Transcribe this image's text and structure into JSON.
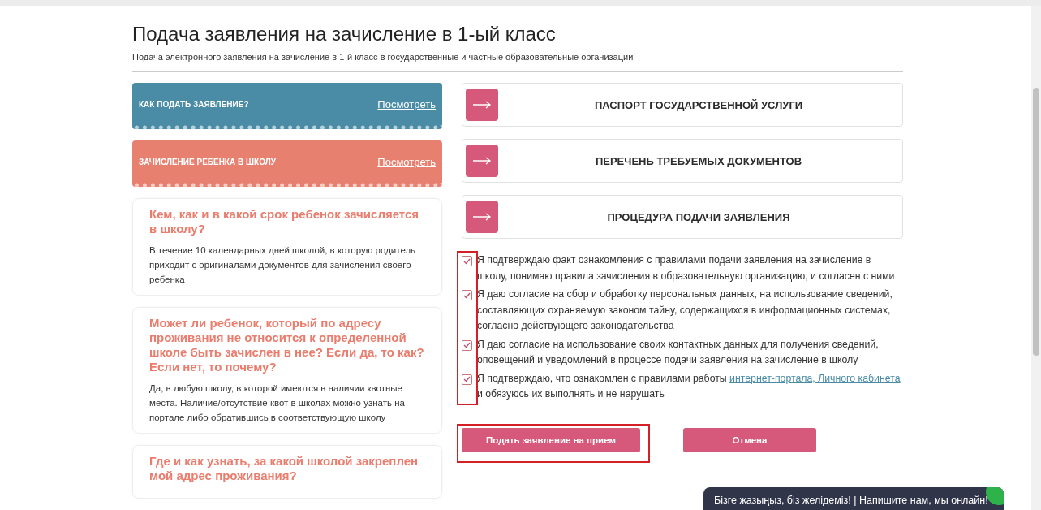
{
  "page": {
    "title": "Подача заявления на зачисление в 1-ый класс",
    "subtitle": "Подача электронного заявления на зачисление в 1-й класс в государственные и частные образовательные организации"
  },
  "banners": [
    {
      "title": "КАК ПОДАТЬ ЗАЯВЛЕНИЕ?",
      "link": "Посмотреть",
      "color": "#4a8ca6"
    },
    {
      "title": "ЗАЧИСЛЕНИЕ РЕБЕНКА В ШКОЛУ",
      "link": "Посмотреть",
      "color": "#e88070"
    }
  ],
  "faq": [
    {
      "question": "Кем, как и в какой срок ребенок зачисляется в школу?",
      "answer": "В течение 10 календарных дней школой, в которую родитель приходит с оригиналами документов для зачисления своего ребенка"
    },
    {
      "question": "Может ли ребенок, который по адресу проживания не относится к определенной школе быть зачислен в нее? Если да, то как? Если нет, то почему?",
      "answer": "Да, в любую школу, в которой имеются в наличии квотные места. Наличие/отсутствие квот в школах можно узнать на портале либо обратившись в соответствующую школу"
    },
    {
      "question": "Где и как узнать, за какой школой закреплен мой адрес проживания?"
    }
  ],
  "sections": [
    {
      "title": "ПАСПОРТ ГОСУДАРСТВЕННОЙ УСЛУГИ"
    },
    {
      "title": "ПЕРЕЧЕНЬ ТРЕБУЕМЫХ ДОКУМЕНТОВ"
    },
    {
      "title": "ПРОЦЕДУРА ПОДАЧИ ЗАЯВЛЕНИЯ"
    }
  ],
  "consents_highlighted": true,
  "consents": [
    {
      "text": "Я подтверждаю факт ознакомления с правилами подачи заявления на зачисление в школу, понимаю правила зачисления в образовательную организацию, и согласен с ними",
      "checked": true
    },
    {
      "text": "Я даю согласие на сбор и обработку персональных данных, на использование сведений, составляющих охраняемую законом тайну, содержащихся в информационных системах, согласно действующего законодательства",
      "checked": true
    },
    {
      "text": "Я даю согласие на использование своих контактных данных для получения сведений, оповещений и уведомлений в процессе подачи заявления на зачисление в школу",
      "checked": true
    },
    {
      "text": "Я подтверждаю, что ознакомлен с правилами работы",
      "link": "интернет-портала, Личного кабинета",
      "text_after": "и обязуюсь их выполнять и не нарушать",
      "checked": true
    }
  ],
  "buttons": [
    {
      "label": "Подать заявление на прием",
      "highlighted": true
    },
    {
      "label": "Отмена",
      "highlighted": false
    }
  ],
  "chat": {
    "text": "Бізге жазыңыз, біз желідеміз! | Напишите нам, мы онлайн!"
  }
}
